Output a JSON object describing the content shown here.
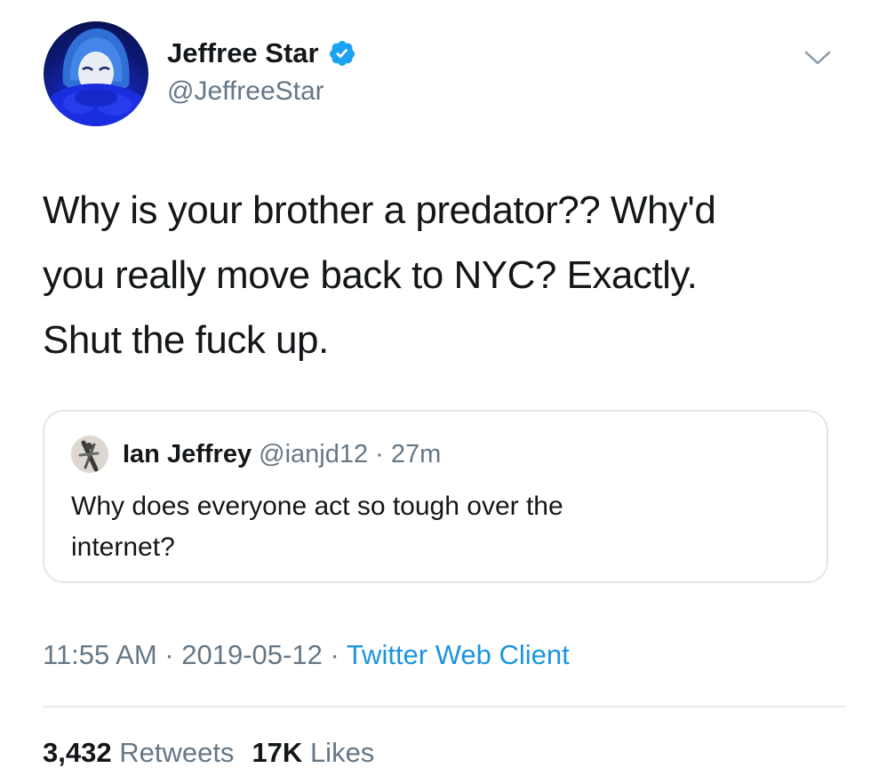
{
  "author": {
    "name": "Jeffree Star",
    "handle": "@JeffreeStar",
    "verified": true
  },
  "tweet": {
    "text_lines": [
      "Why is your brother a predator?? Why'd",
      "you really move back to NYC? Exactly.",
      "Shut the fuck up."
    ]
  },
  "quoted_tweet": {
    "name": "Ian Jeffrey",
    "handle": "@ianjd12",
    "separator": " · ",
    "time_ago": "27m",
    "text_lines": [
      "Why does everyone act so tough over the",
      "internet?"
    ]
  },
  "meta": {
    "time": "11:55 AM",
    "sep1": " · ",
    "date": "2019-05-12",
    "sep2": " · ",
    "client": "Twitter Web Client"
  },
  "stats": {
    "retweets_count": "3,432",
    "retweets_label": "Retweets",
    "likes_count": "17K",
    "likes_label": "Likes"
  },
  "colors": {
    "text": "#14171a",
    "secondary": "#657786",
    "link": "#1b95e0",
    "verified": "#1da1f2",
    "border": "#e1e8ed"
  },
  "icons": {
    "verified": "verified-badge-icon",
    "menu": "chevron-down-icon"
  }
}
